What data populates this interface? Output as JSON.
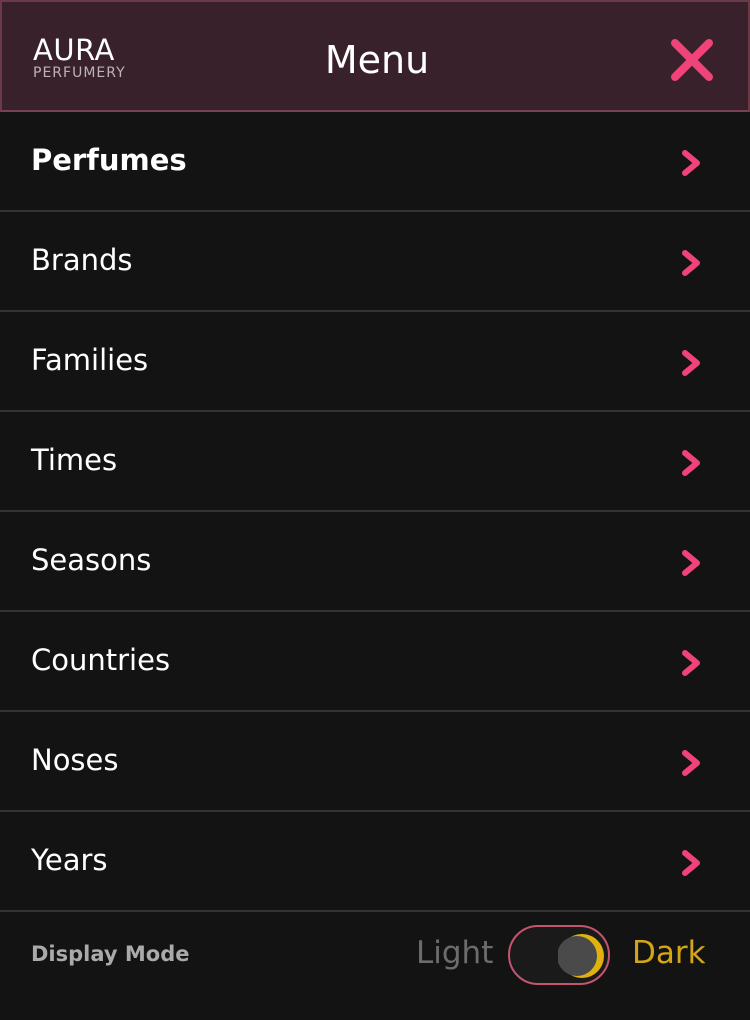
{
  "header": {
    "logo_name": "AURA",
    "logo_sub": "PERFUMERY",
    "title": "Menu",
    "close_icon": "close-x-icon"
  },
  "menu": {
    "items": [
      {
        "label": "Perfumes",
        "active": true
      },
      {
        "label": "Brands"
      },
      {
        "label": "Families"
      },
      {
        "label": "Times"
      },
      {
        "label": "Seasons"
      },
      {
        "label": "Countries"
      },
      {
        "label": "Noses"
      },
      {
        "label": "Years"
      }
    ],
    "chevron_icon": "chevron-right-icon"
  },
  "footer": {
    "label": "Display Mode",
    "light_label": "Light",
    "dark_label": "Dark",
    "mode": "dark"
  },
  "colors": {
    "accent": "#f0437a",
    "header_bg": "#38212a",
    "background": "#131313",
    "dark_mode_yellow": "#d4a516"
  }
}
